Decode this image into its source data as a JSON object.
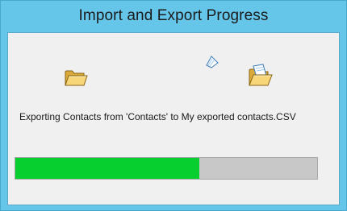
{
  "window": {
    "title": "Import and Export Progress"
  },
  "animation": {
    "source_icon": "folder-icon",
    "moving_icon": "paper-sheet-icon",
    "destination_icon": "open-folder-icon"
  },
  "status": {
    "message": "Exporting Contacts from 'Contacts' to My exported contacts.CSV"
  },
  "progress": {
    "fraction": 0.61,
    "fill_color": "#06cf2f",
    "track_color": "#c8c8c8"
  },
  "colors": {
    "titlebar": "#65c6ea",
    "client_background": "#f0f0f0"
  }
}
